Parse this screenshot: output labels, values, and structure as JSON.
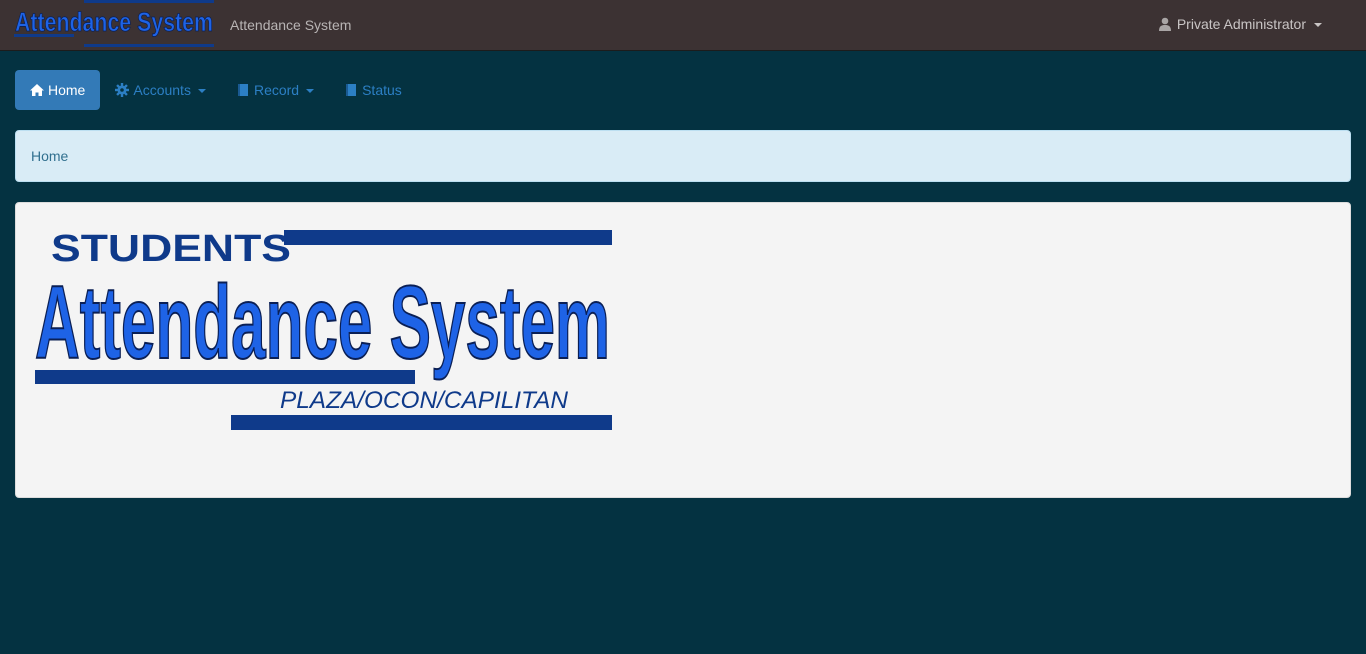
{
  "topbar": {
    "logo_text": "Attendance System",
    "brand": "Attendance System",
    "user": "Private Administrator"
  },
  "nav": {
    "items": [
      {
        "label": "Home",
        "icon": "home-icon",
        "active": true
      },
      {
        "label": "Accounts",
        "icon": "gear-icon",
        "dropdown": true
      },
      {
        "label": "Record",
        "icon": "book-icon",
        "dropdown": true
      },
      {
        "label": "Status",
        "icon": "book-icon"
      }
    ]
  },
  "breadcrumb": {
    "current": "Home"
  },
  "logo": {
    "line1": "STUDENTS",
    "line2": "Attendance System",
    "line3": "PLAZA/OCON/CAPILITAN"
  },
  "colors": {
    "page_bg": "#043241",
    "topbar_bg": "#3c3233",
    "logo_blue": "#1e63e6",
    "logo_navy": "#0f3a8a",
    "active_pill": "#337ab7"
  }
}
